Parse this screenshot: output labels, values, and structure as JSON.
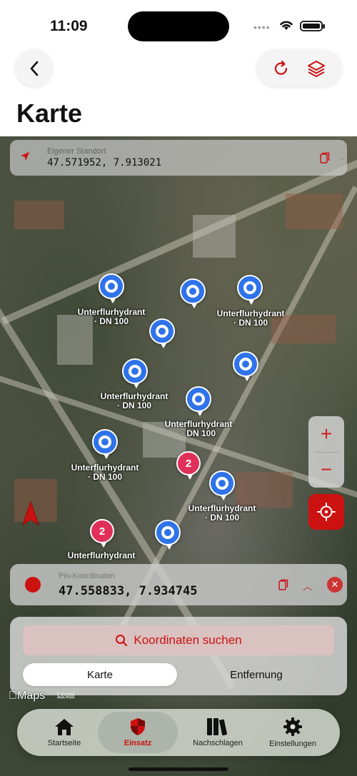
{
  "status_bar": {
    "time": "11:09"
  },
  "header": {
    "title": "Karte"
  },
  "location_card": {
    "label": "Eigener Standort",
    "value": "47.571952, 7.913021"
  },
  "map": {
    "pins": [
      {
        "label_line1": "Unterflurhydrant",
        "label_line2": "· DN 100"
      },
      {
        "label_line1": "Unterflurhydrant",
        "label_line2": "· DN 100"
      },
      {
        "label_line1": "Unterflurhydrant",
        "label_line2": "· DN 100"
      },
      {
        "label_line1": "Unterflurhydrant",
        "label_line2": "· DN 100"
      },
      {
        "label_line1": "Unterflurhydrant",
        "label_line2": "· DN 100"
      },
      {
        "label_line1": "Unterflurhydrant",
        "label_line2": "· DN 100"
      },
      {
        "label_line1": "Unterflurhydrant",
        "label_line2": ""
      }
    ],
    "clusters": [
      "2",
      "2"
    ],
    "zoom_in": "+",
    "zoom_out": "−",
    "attribution": "Maps",
    "legal": "Legal"
  },
  "pin_card": {
    "label": "Pin-Koordinaten",
    "value": "47.558833, 7.934745"
  },
  "panel": {
    "search_label": "Koordinaten suchen",
    "segments": [
      "Karte",
      "Entfernung"
    ]
  },
  "tabs": [
    {
      "label": "Startseite",
      "icon": "house-icon"
    },
    {
      "label": "Einsatz",
      "icon": "shield-icon"
    },
    {
      "label": "Nachschlagen",
      "icon": "books-icon"
    },
    {
      "label": "Einstellungen",
      "icon": "gear-icon"
    }
  ],
  "colors": {
    "accent": "#cc1111",
    "pin_blue": "#2f73ea",
    "cluster_pink": "#e0305a"
  }
}
